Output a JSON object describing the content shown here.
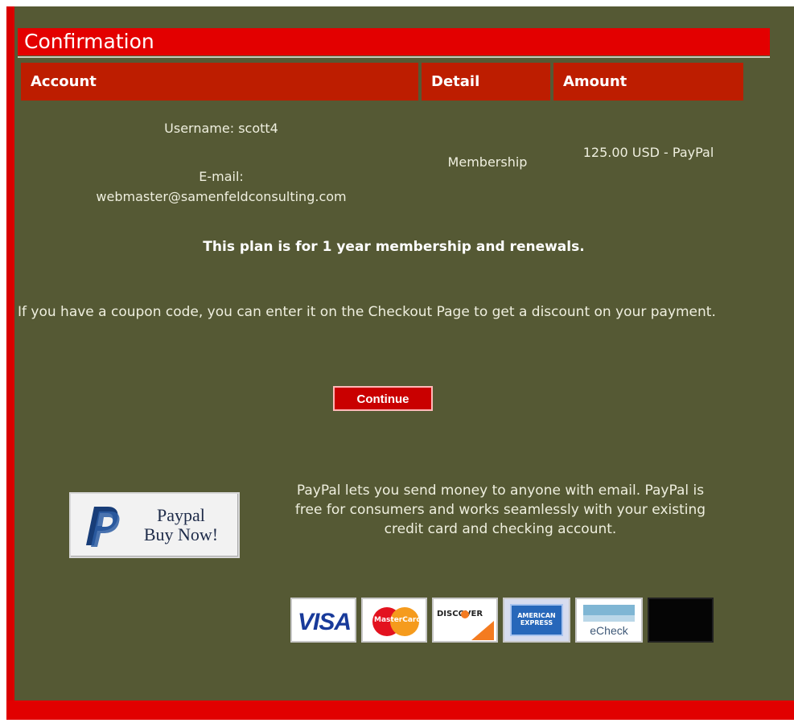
{
  "page": {
    "title": "Confirmation"
  },
  "table": {
    "headers": [
      "Account",
      "Detail",
      "Amount"
    ],
    "row": {
      "username": "Username: scott4",
      "email_label": "E-mail:",
      "email": "webmaster@samenfeldconsulting.com",
      "detail": "Membership",
      "amount": "125.00 USD - PayPal"
    }
  },
  "messages": {
    "plan": "This plan is for 1 year membership and renewals.",
    "coupon": "If you have a coupon code, you can enter it on the Checkout Page to get a discount on your payment."
  },
  "actions": {
    "continue": "Continue"
  },
  "paypal": {
    "button_line1": "Paypal",
    "button_line2": "Buy Now!",
    "description": "PayPal lets you send money to anyone with email. PayPal is free for consumers and works seamlessly with your existing credit card and checking account."
  },
  "cards": {
    "visa": "VISA",
    "mastercard": "MasterCard",
    "discover": "DISCOVER",
    "amex": "AMERICAN EXPRESS",
    "echeck": "eCheck"
  },
  "colors": {
    "panel": "#555934",
    "accent": "#e30000"
  }
}
